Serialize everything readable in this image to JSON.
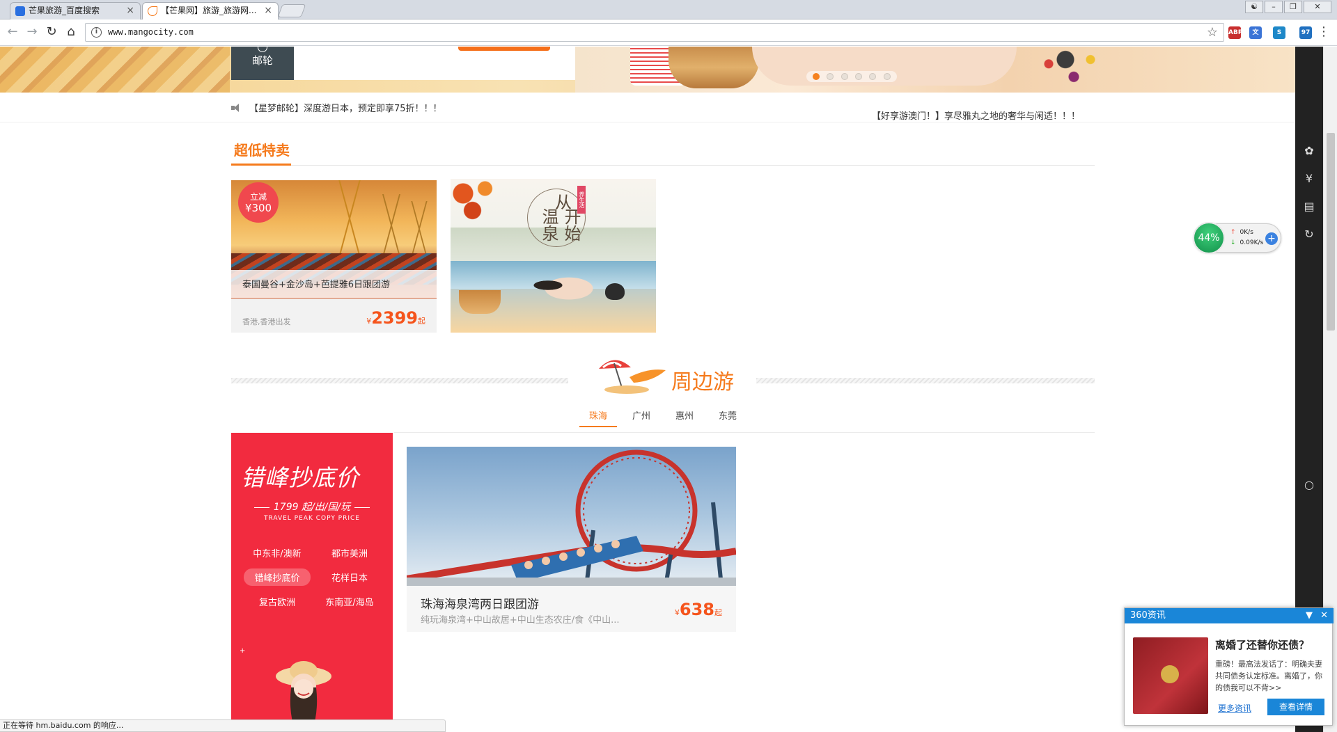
{
  "browser": {
    "tabs": [
      {
        "title": "芒果旅游_百度搜索",
        "active": false
      },
      {
        "title": "【芒果网】旅游_旅游网...",
        "active": true
      }
    ],
    "url": "www.mangocity.com",
    "status_text": "正在等待 hm.baidu.com 的响应...",
    "extensions": [
      {
        "icon": "abp-icon",
        "color": "#c82e2e",
        "label": "ABP"
      },
      {
        "icon": "translate-icon",
        "color": "#3b74d6",
        "label": "文"
      },
      {
        "icon": "s-extension-icon",
        "color": "#1e88c8",
        "label": "S"
      },
      {
        "icon": "notification-icon",
        "color": "#2070c0",
        "label": "97"
      }
    ]
  },
  "banner": {
    "category_tile": "邮轮",
    "carousel_active_index": 0,
    "carousel_count": 6
  },
  "notices": {
    "primary": "【星梦邮轮】深度游日本，预定即享75折！！！",
    "secondary": "【好享游澳门！】享尽雅丸之地的奢华与闲适！！！"
  },
  "special": {
    "title": "超低特卖",
    "card1": {
      "badge_line1": "立减",
      "badge_line2": "¥300",
      "name": "泰国曼谷+金沙岛+芭提雅6日跟团游",
      "departure": "香港,香港出发",
      "currency": "¥",
      "price": "2399",
      "price_suffix": "起"
    },
    "card2": {
      "tag": "养生活",
      "line1": "从",
      "line2": "温泉",
      "line3": "开始"
    }
  },
  "nearby": {
    "title": "周边游",
    "tabs": [
      "珠海",
      "广州",
      "惠州",
      "东莞"
    ],
    "active_tab": 0,
    "promo": {
      "headline": "错峰抄底价",
      "sub": "1799 起/出/国/玩",
      "en": "TRAVEL PEAK COPY PRICE",
      "menu": [
        "中东非/澳新",
        "都市美洲",
        "错峰抄底价",
        "花样日本",
        "复古欧洲",
        "东南亚/海岛"
      ],
      "active_menu": 2,
      "plus": "+"
    },
    "product": {
      "name": "珠海海泉湾两日跟团游",
      "desc": "纯玩海泉湾+中山故居+中山生态农庄/食《中山...",
      "currency": "¥",
      "price": "638",
      "price_suffix": "起"
    }
  },
  "speed_widget": {
    "percent": "44%",
    "upload": "0K/s",
    "download": "0.09K/s"
  },
  "news_popup": {
    "header": "360资讯",
    "title": "离婚了还替你还债？",
    "body": "重磅！最高法发话了：明确夫妻共同债务认定标准。离婚了，你的债我可以不背>>",
    "more_link": "更多资讯",
    "detail_button": "查看详情"
  },
  "colors": {
    "brand_orange": "#f57a1c",
    "price_red": "#f5541c",
    "promo_red": "#f22b3f",
    "news_blue": "#1a86d8"
  }
}
